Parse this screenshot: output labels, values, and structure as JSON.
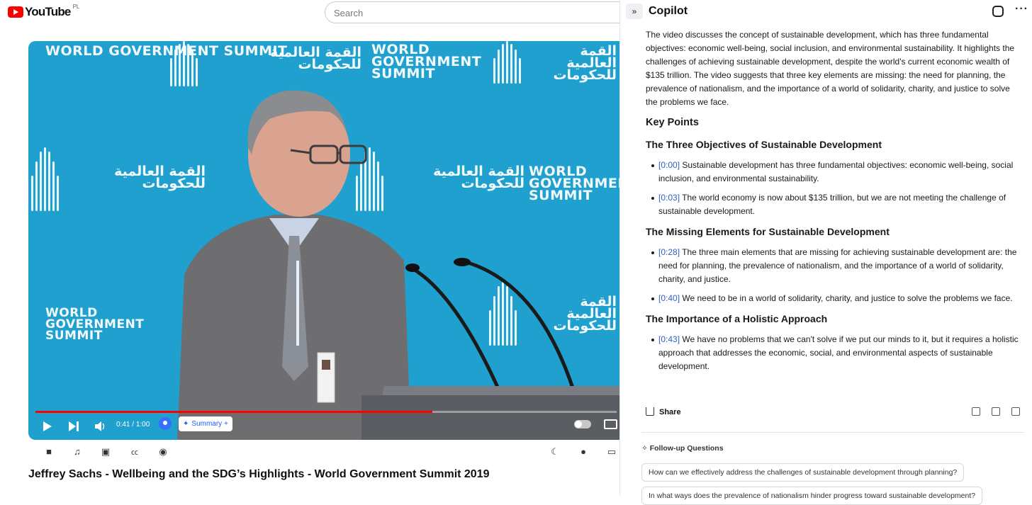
{
  "youtube": {
    "logo_text": "YouTube",
    "region": "PL",
    "search_placeholder": "Search",
    "player": {
      "stage_text": "WORLD GOVERNMENT SUMMIT",
      "stage_text_arabic": "القمة العالمية للحكومات",
      "time_current": "0:41",
      "time_total": "1:00",
      "progress": 0.683,
      "summary_label": "Summary +"
    },
    "video_title": "Jeffrey Sachs - Wellbeing and the SDG’s Highlights - World Government Summit 2019"
  },
  "copilot": {
    "title": "Copilot",
    "intro": "The video discusses the concept of sustainable development, which has three fundamental objectives: economic well-being, social inclusion, and environmental sustainability. It highlights the challenges of achieving sustainable development, despite the world's current economic wealth of $135 trillion. The video suggests that three key elements are missing: the need for planning, the prevalence of nationalism, and the importance of a world of solidarity, charity, and justice to solve the problems we face.",
    "key_points_heading": "Key Points",
    "sections": [
      {
        "heading": "The Three Objectives of Sustainable Development",
        "points": [
          {
            "ts": "[0:00]",
            "text": "Sustainable development has three fundamental objectives: economic well-being, social inclusion, and environmental sustainability."
          },
          {
            "ts": "[0:03]",
            "text": "The world economy is now about $135 trillion, but we are not meeting the challenge of sustainable development."
          }
        ]
      },
      {
        "heading": "The Missing Elements for Sustainable Development",
        "points": [
          {
            "ts": "[0:28]",
            "text": "The three main elements that are missing for achieving sustainable development are: the need for planning, the prevalence of nationalism, and the importance of a world of solidarity, charity, and justice."
          },
          {
            "ts": "[0:40]",
            "text": "We need to be in a world of solidarity, charity, and justice to solve the problems we face."
          }
        ]
      },
      {
        "heading": "The Importance of a Holistic Approach",
        "points": [
          {
            "ts": "[0:43]",
            "text": "We have no problems that we can't solve if we put our minds to it, but it requires a holistic approach that addresses the economic, social, and environmental aspects of sustainable development."
          }
        ]
      }
    ],
    "share_label": "Share",
    "followup_label": "Follow-up Questions",
    "followups": [
      "How can we effectively address the challenges of sustainable development through planning?",
      "In what ways does the prevalence of nationalism hinder progress toward sustainable development?"
    ]
  }
}
